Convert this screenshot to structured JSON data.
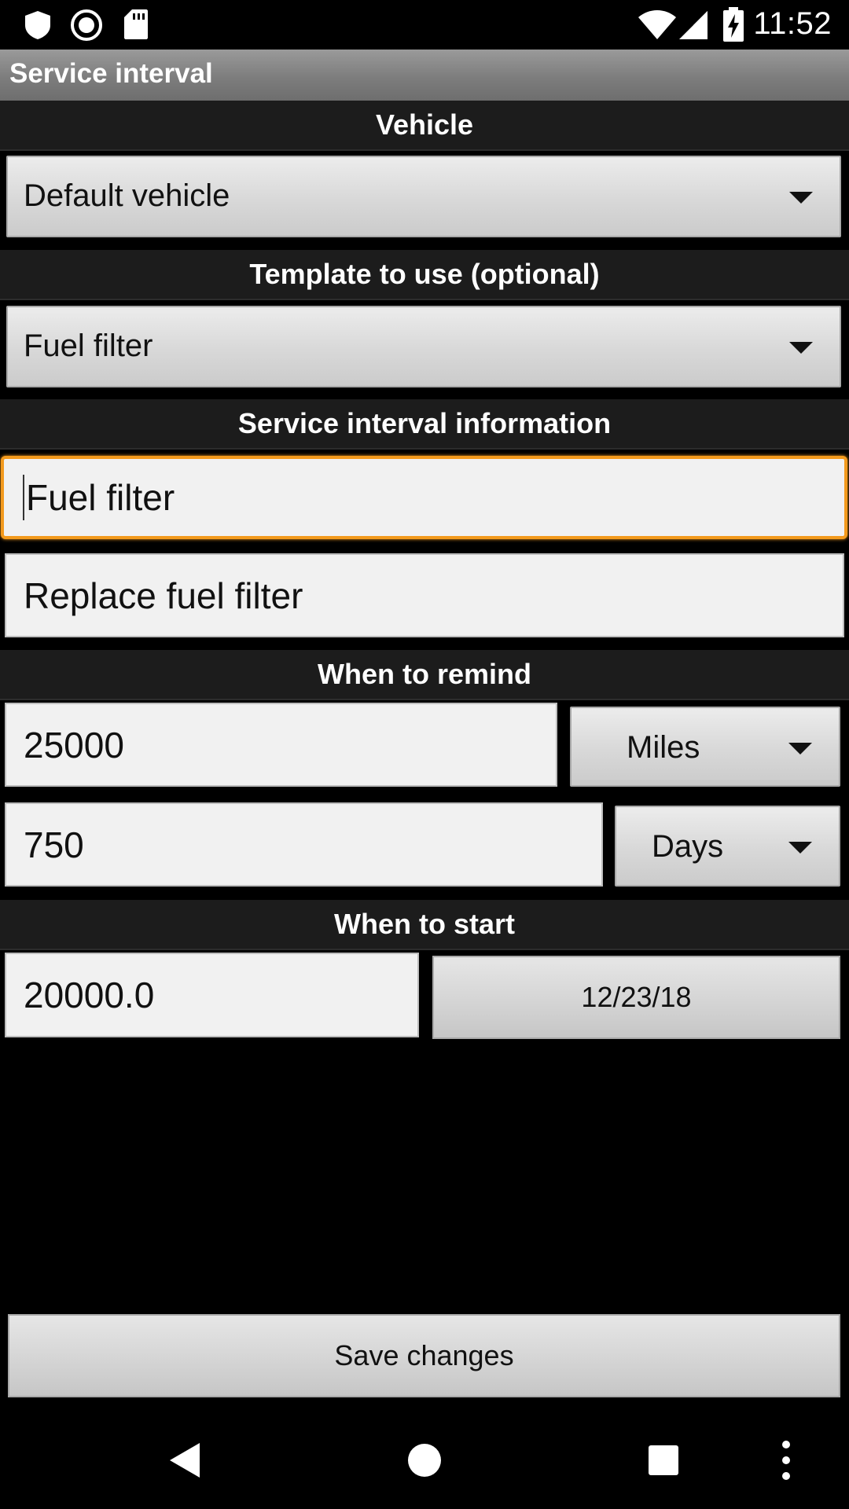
{
  "status_bar": {
    "time": "11:52",
    "icons": [
      "shield-icon",
      "record-icon",
      "sd-card-icon",
      "wifi-icon",
      "cell-signal-icon",
      "battery-charging-icon"
    ]
  },
  "title_bar": {
    "title": "Service interval"
  },
  "sections": {
    "vehicle": "Vehicle",
    "template": "Template to use (optional)",
    "info": "Service interval information",
    "remind": "When to remind",
    "start": "When to start"
  },
  "vehicle_spinner": {
    "value": "Default vehicle"
  },
  "template_spinner": {
    "value": "Fuel filter"
  },
  "info": {
    "name_value": "Fuel filter",
    "description_value": "Replace fuel filter"
  },
  "remind": {
    "distance_value": "25000",
    "distance_unit": "Miles",
    "time_value": "750",
    "time_unit": "Days"
  },
  "start": {
    "odometer_value": "20000.0",
    "date_label": "12/23/18"
  },
  "save_button": {
    "label": "Save changes"
  },
  "nav_bar": {
    "icons": [
      "back-icon",
      "home-icon",
      "recents-icon",
      "overflow-menu-icon"
    ]
  },
  "colors": {
    "focus": "#f39a1d",
    "background": "#000000",
    "header": "#1c1c1c"
  }
}
